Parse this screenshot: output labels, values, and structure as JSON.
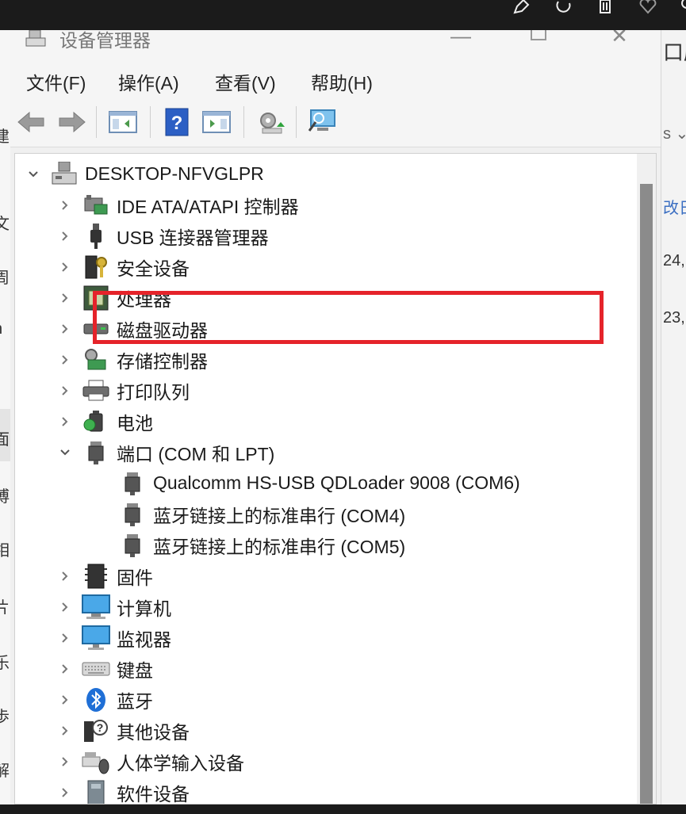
{
  "window": {
    "title": "设备管理器",
    "icon": "device-manager-icon"
  },
  "menu": [
    "文件(F)",
    "操作(A)",
    "查看(V)",
    "帮助(H)"
  ],
  "toolbar_icons": [
    "back-arrow-icon",
    "forward-arrow-icon",
    "show-hide-console-tree-icon",
    "help-icon",
    "action-pane-icon",
    "update-driver-icon",
    "scan-hardware-icon"
  ],
  "tree": {
    "root": "DESKTOP-NFVGLPR",
    "items": [
      {
        "label": "IDE ATA/ATAPI 控制器",
        "icon": "ide-controller-icon",
        "expanded": false
      },
      {
        "label": "USB 连接器管理器",
        "icon": "usb-connector-icon",
        "expanded": false
      },
      {
        "label": "安全设备",
        "icon": "security-device-icon",
        "expanded": false
      },
      {
        "label": "处理器",
        "icon": "processor-icon",
        "expanded": false
      },
      {
        "label": "磁盘驱动器",
        "icon": "disk-drive-icon",
        "expanded": false
      },
      {
        "label": "存储控制器",
        "icon": "storage-controller-icon",
        "expanded": false
      },
      {
        "label": "打印队列",
        "icon": "printer-icon",
        "expanded": false
      },
      {
        "label": "电池",
        "icon": "battery-icon",
        "expanded": false
      },
      {
        "label": "端口 (COM 和 LPT)",
        "icon": "port-icon",
        "expanded": true,
        "children": [
          {
            "label": "Qualcomm HS-USB QDLoader 9008 (COM6)",
            "icon": "port-icon",
            "highlighted": true
          },
          {
            "label": "蓝牙链接上的标准串行 (COM4)",
            "icon": "port-icon"
          },
          {
            "label": "蓝牙链接上的标准串行 (COM5)",
            "icon": "port-icon"
          }
        ]
      },
      {
        "label": "固件",
        "icon": "firmware-icon",
        "expanded": false
      },
      {
        "label": "计算机",
        "icon": "computer-icon",
        "expanded": false
      },
      {
        "label": "监视器",
        "icon": "monitor-icon",
        "expanded": false
      },
      {
        "label": "键盘",
        "icon": "keyboard-icon",
        "expanded": false
      },
      {
        "label": "蓝牙",
        "icon": "bluetooth-icon",
        "expanded": false
      },
      {
        "label": "其他设备",
        "icon": "other-devices-icon",
        "expanded": false
      },
      {
        "label": "人体学输入设备",
        "icon": "hid-icon",
        "expanded": false
      },
      {
        "label": "软件设备",
        "icon": "software-device-icon",
        "expanded": false
      }
    ]
  },
  "background_right": [
    "口魔",
    "s ⌄",
    "改日",
    "24,",
    "23,"
  ],
  "background_left": [
    "建",
    "文",
    "周",
    "n",
    "面",
    "博",
    "相",
    "片",
    "乐",
    "歩",
    "解"
  ],
  "highlight_color": "#e5232a"
}
